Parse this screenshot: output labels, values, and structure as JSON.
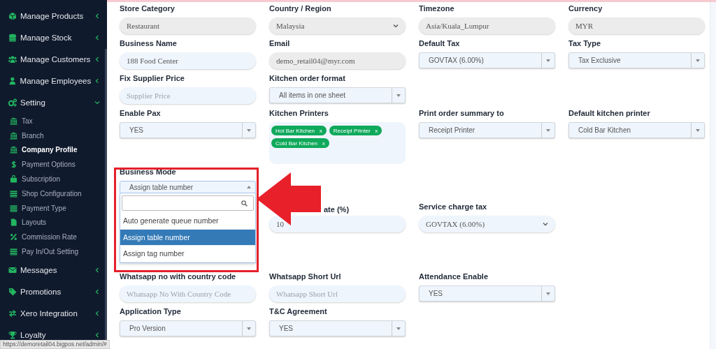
{
  "sidebar": {
    "items": [
      {
        "label": "Manage Products",
        "expanded": false
      },
      {
        "label": "Manage Stock",
        "expanded": false
      },
      {
        "label": "Manage Customers",
        "expanded": false
      },
      {
        "label": "Manage Employees",
        "expanded": false
      },
      {
        "label": "Setting",
        "expanded": true,
        "children": [
          {
            "label": "Tax",
            "selected": false
          },
          {
            "label": "Branch",
            "selected": false
          },
          {
            "label": "Company Profile",
            "selected": true
          },
          {
            "label": "Payment Options",
            "selected": false
          },
          {
            "label": "Subscription",
            "selected": false
          },
          {
            "label": "Shop Configuration",
            "selected": false
          },
          {
            "label": "Payment Type",
            "selected": false
          },
          {
            "label": "Layouts",
            "selected": false
          },
          {
            "label": "Commission Rate",
            "selected": false
          },
          {
            "label": "Pay In/Out Setting",
            "selected": false
          }
        ]
      },
      {
        "label": "Messages",
        "expanded": false
      },
      {
        "label": "Promotions",
        "expanded": false
      },
      {
        "label": "Xero Integration",
        "expanded": false
      },
      {
        "label": "Loyalty",
        "expanded": false
      }
    ]
  },
  "form": {
    "rows": [
      [
        {
          "label": "Store Category",
          "kind": "text",
          "disabled": true,
          "value": "Restaurant"
        },
        {
          "label": "Country / Region",
          "kind": "dropdown",
          "disabled": true,
          "value": "Malaysia"
        },
        {
          "label": "Timezone",
          "kind": "text",
          "disabled": true,
          "value": "Asia/Kuala_Lumpur"
        },
        {
          "label": "Currency",
          "kind": "text",
          "disabled": true,
          "value": "MYR"
        }
      ],
      [
        {
          "label": "Business Name",
          "kind": "text",
          "disabled": false,
          "value": "188 Food Center"
        },
        {
          "label": "Email",
          "kind": "text",
          "disabled": true,
          "value": "demo_retail04@myr.com"
        },
        {
          "label": "Default Tax",
          "kind": "select",
          "value": "GOVTAX (6.00%)"
        },
        {
          "label": "Tax Type",
          "kind": "select",
          "value": "Tax Exclusive"
        }
      ],
      [
        {
          "label": "Fix Supplier Price",
          "kind": "text",
          "disabled": false,
          "placeholder": "Supplier Price"
        },
        {
          "label": "Kitchen order format",
          "kind": "select",
          "value": "All items in one sheet"
        },
        null,
        null
      ],
      [
        {
          "label": "Enable Pax",
          "kind": "select",
          "value": "YES"
        },
        {
          "label": "Kitchen Printers",
          "kind": "tags",
          "tags": [
            {
              "label": "Hot Bar Kitchen",
              "remove": "x"
            },
            {
              "label": "Receipt Printer",
              "remove": "x"
            },
            {
              "label": "Cold Bar Kitchen",
              "remove": "x"
            }
          ]
        },
        {
          "label": "Print order summary to",
          "kind": "select",
          "value": "Receipt Printer"
        },
        {
          "label": "Default kitchen printer",
          "kind": "select",
          "value": "Cold Bar Kitchen"
        }
      ],
      [
        {
          "label": "Business Mode",
          "kind": "select",
          "value": "Assign table number",
          "open": true,
          "options": [
            {
              "label": "Auto generate queue number",
              "selected": false
            },
            {
              "label": "Assign table number",
              "selected": true
            },
            {
              "label": "Assign tag number",
              "selected": false
            }
          ]
        },
        null,
        null,
        null
      ],
      [
        null,
        {
          "label": "ate (%)",
          "kind": "text",
          "disabled": false,
          "covered": true,
          "value": "10"
        },
        {
          "label": "Service charge tax",
          "kind": "dropdown",
          "disabled": false,
          "value": "GOVTAX (6.00%)"
        },
        null
      ],
      [
        null,
        null,
        null,
        null
      ],
      [
        {
          "label": "Whatsapp no with country code",
          "kind": "text",
          "disabled": false,
          "placeholder": "Whatsapp No With Country Code"
        },
        {
          "label": "Whatsapp Short Url",
          "kind": "text",
          "disabled": false,
          "placeholder": "Whatsapp Short Url"
        },
        {
          "label": "Attendance Enable",
          "kind": "select",
          "value": "YES"
        },
        null
      ],
      [
        {
          "label": "Application Type",
          "kind": "select",
          "value": "Pro Version"
        },
        {
          "label": "T&C Agreement",
          "kind": "select",
          "value": "YES"
        },
        null,
        null
      ]
    ]
  },
  "status_url": "https://demoretail04.bigpos.net/admin/#"
}
